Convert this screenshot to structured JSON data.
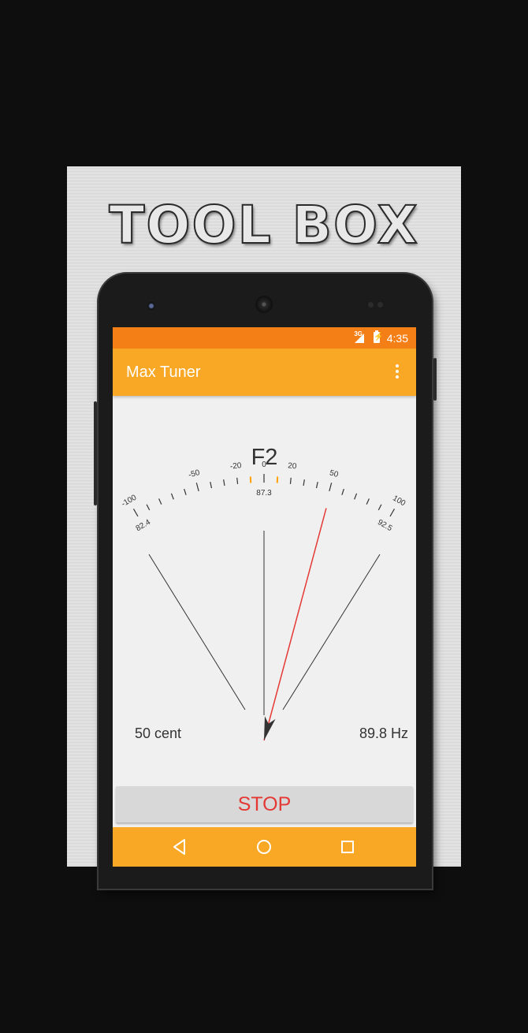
{
  "promo": {
    "title": "TOOL BOX"
  },
  "status_bar": {
    "network": "3G",
    "time": "4:35"
  },
  "app_bar": {
    "title": "Max Tuner",
    "menu_icon": "more-vert-icon"
  },
  "tuner": {
    "note": "F2",
    "cent_labels": [
      "-100",
      "-50",
      "-20",
      "0",
      "20",
      "50",
      "100"
    ],
    "freq_low": "82.4",
    "freq_center": "87.3",
    "freq_high": "92.5",
    "cent_readout": "50 cent",
    "hz_readout": "89.8 Hz",
    "needle_cents": 50,
    "accent_color": "#ffa000",
    "needle_color": "#e53935"
  },
  "actions": {
    "stop_label": "STOP"
  },
  "nav_bar": {
    "icons": [
      "back-icon",
      "home-icon",
      "recents-icon"
    ]
  },
  "colors": {
    "status_bar": "#f57f17",
    "app_bar": "#f9a825",
    "stop_text": "#e53935"
  }
}
